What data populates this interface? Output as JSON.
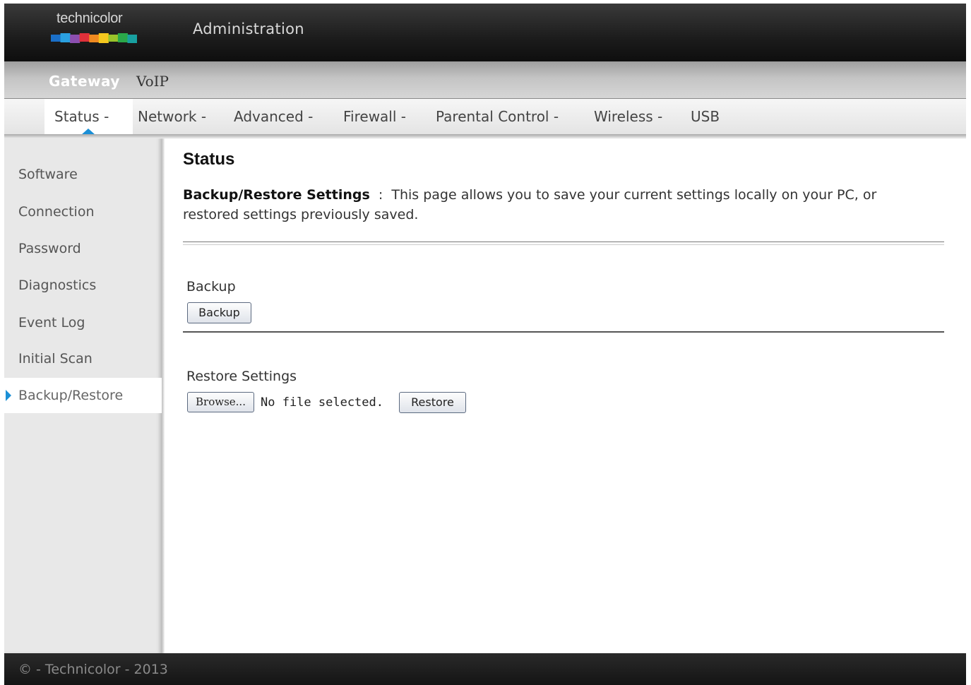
{
  "brand": {
    "logo_text": "technicolor",
    "logo_bar_colors": [
      "#1a6fc8",
      "#2aa0e0",
      "#8c4fb0",
      "#e0303a",
      "#f08a20",
      "#f5c81e",
      "#9ac42a",
      "#2aa84a",
      "#18a0a0"
    ]
  },
  "header": {
    "title": "Administration"
  },
  "topmenu": {
    "items": [
      "Gateway",
      "VoIP"
    ]
  },
  "submenu": {
    "items": [
      "Status -",
      "Network -",
      "Advanced -",
      "Firewall -",
      "Parental Control -",
      "Wireless -",
      "USB"
    ],
    "active": "Status -"
  },
  "sidebar": {
    "items": [
      "Software",
      "Connection",
      "Password",
      "Diagnostics",
      "Event Log",
      "Initial Scan",
      "Backup/Restore"
    ],
    "active": "Backup/Restore"
  },
  "main": {
    "title": "Status",
    "desc_strong": "Backup/Restore Settings",
    "desc_text": "  :  This page allows you to save your current settings locally on your PC, or restored settings previously saved.",
    "backup": {
      "label": "Backup",
      "button": "Backup"
    },
    "restore": {
      "label": "Restore Settings",
      "browse_button": "Browse...",
      "file_status": "No file selected.",
      "restore_button": "Restore"
    }
  },
  "footer": {
    "text": "© - Technicolor - 2013"
  },
  "colors": {
    "accent": "#1a8fd6",
    "header_bg": "#1c1c1c"
  }
}
